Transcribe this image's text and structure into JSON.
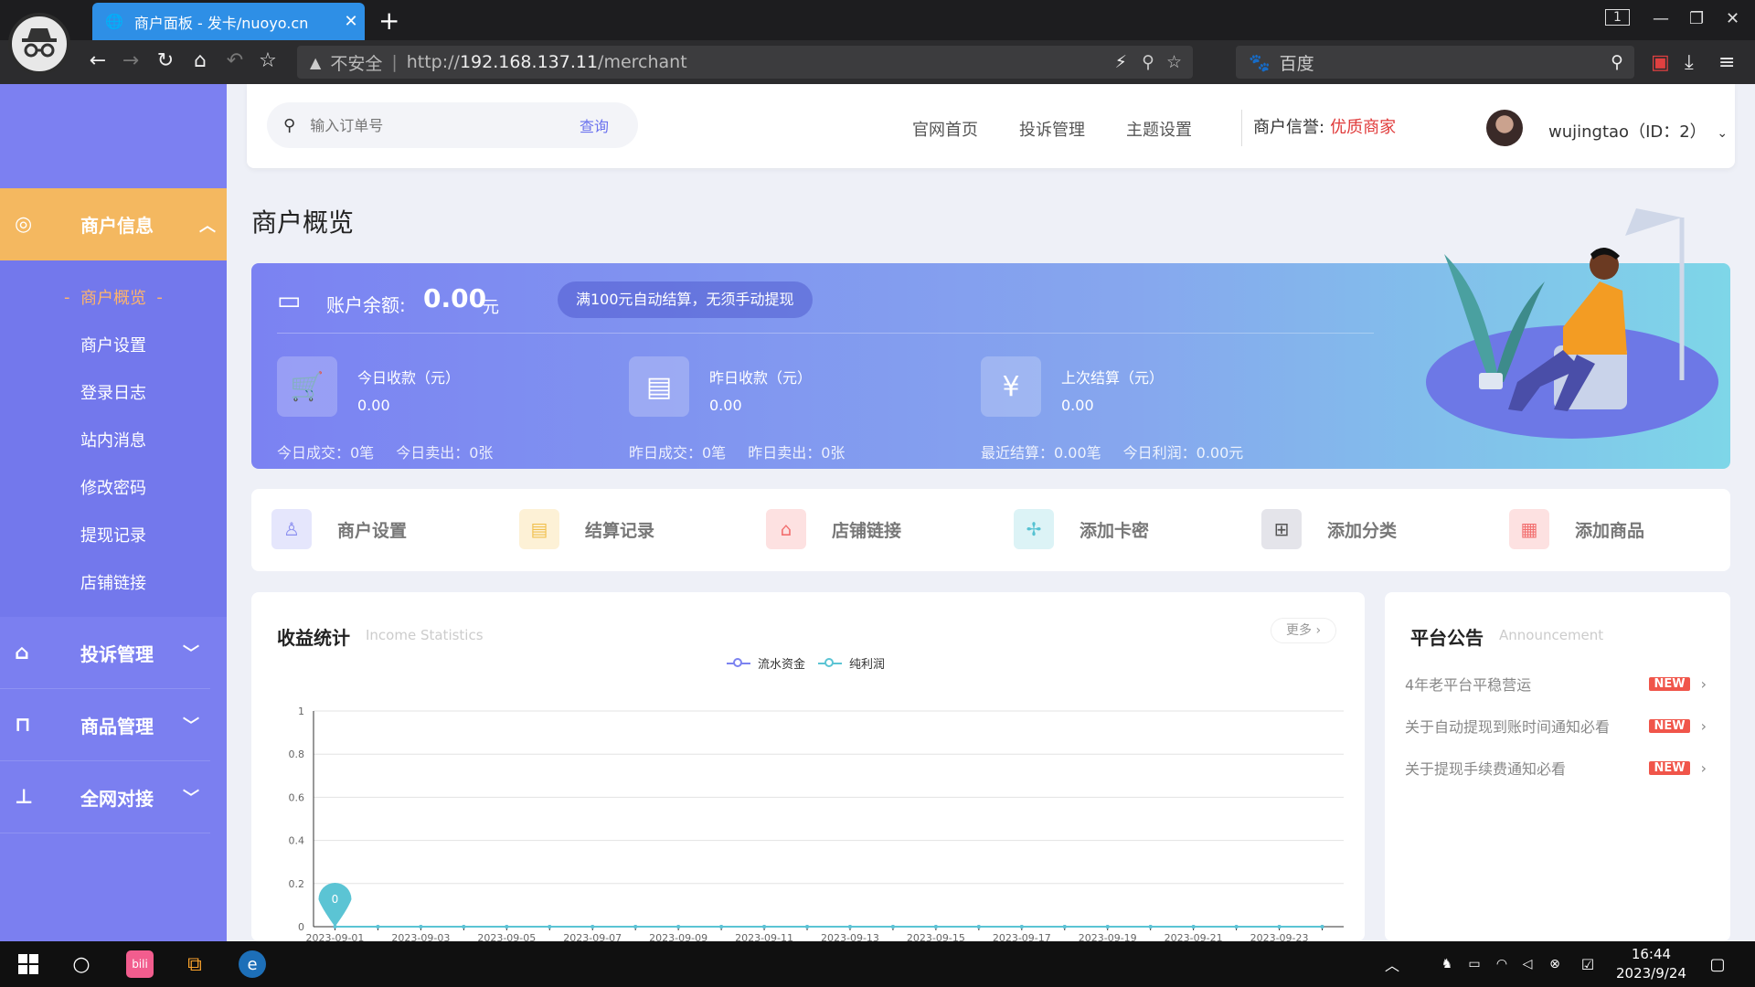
{
  "browser": {
    "tab_title": "商户面板 - 发卡/nuoyo.cn",
    "tab_count": "1",
    "url_warning": "不安全",
    "url_prefix": "http://",
    "url_host": "192.168.137.11",
    "url_path": "/merchant",
    "search_engine": "百度"
  },
  "sidebar": {
    "open_group": "商户信息",
    "sub_items": [
      "商户概览",
      "商户设置",
      "登录日志",
      "站内消息",
      "修改密码",
      "提现记录",
      "店铺链接"
    ],
    "groups": [
      "投诉管理",
      "商品管理",
      "全网对接"
    ]
  },
  "header": {
    "search_placeholder": "输入订单号",
    "search_button": "查询",
    "nav": [
      "官网首页",
      "投诉管理",
      "主题设置"
    ],
    "credit_label": "商户信誉:",
    "credit_value": "优质商家",
    "user": "wujingtao（ID：2）"
  },
  "page_title": "商户概览",
  "balance": {
    "label": "账户余额:",
    "value": "0.00",
    "unit": "元",
    "notice": "满100元自动结算，无须手动提现"
  },
  "stats": [
    {
      "label": "今日收款（元）",
      "value": "0.00",
      "foot1": "今日成交：0笔",
      "foot2": "今日卖出：0张"
    },
    {
      "label": "昨日收款（元）",
      "value": "0.00",
      "foot1": "昨日成交：0笔",
      "foot2": "昨日卖出：0张"
    },
    {
      "label": "上次结算（元）",
      "value": "0.00",
      "foot1": "最近结算：0.00笔",
      "foot2": "今日利润：0.00元"
    }
  ],
  "quick_actions": [
    "商户设置",
    "结算记录",
    "店铺链接",
    "添加卡密",
    "添加分类",
    "添加商品"
  ],
  "income": {
    "title": "收益统计",
    "subtitle": "Income Statistics",
    "more": "更多 ›",
    "pin_label": "0"
  },
  "chart_data": {
    "type": "line",
    "x": [
      "2023-09-01",
      "2023-09-02",
      "2023-09-03",
      "2023-09-04",
      "2023-09-05",
      "2023-09-06",
      "2023-09-07",
      "2023-09-08",
      "2023-09-09",
      "2023-09-10",
      "2023-09-11",
      "2023-09-12",
      "2023-09-13",
      "2023-09-14",
      "2023-09-15",
      "2023-09-16",
      "2023-09-17",
      "2023-09-18",
      "2023-09-19",
      "2023-09-20",
      "2023-09-21",
      "2023-09-22",
      "2023-09-23",
      "2023-09-24"
    ],
    "x_tick_labels": [
      "2023-09-01",
      "2023-09-03",
      "2023-09-05",
      "2023-09-07",
      "2023-09-09",
      "2023-09-11",
      "2023-09-13",
      "2023-09-15",
      "2023-09-17",
      "2023-09-19",
      "2023-09-21",
      "2023-09-23"
    ],
    "y_ticks": [
      "0",
      "0.2",
      "0.4",
      "0.6",
      "0.8",
      "1"
    ],
    "ylim": [
      0,
      1
    ],
    "series": [
      {
        "name": "流水资金",
        "color": "#7c83f0",
        "values": [
          0,
          0,
          0,
          0,
          0,
          0,
          0,
          0,
          0,
          0,
          0,
          0,
          0,
          0,
          0,
          0,
          0,
          0,
          0,
          0,
          0,
          0,
          0,
          0
        ]
      },
      {
        "name": "纯利润",
        "color": "#5bc4d4",
        "values": [
          0,
          0,
          0,
          0,
          0,
          0,
          0,
          0,
          0,
          0,
          0,
          0,
          0,
          0,
          0,
          0,
          0,
          0,
          0,
          0,
          0,
          0,
          0,
          0
        ]
      }
    ],
    "grid": true,
    "legend": "top-center"
  },
  "announce": {
    "title": "平台公告",
    "subtitle": "Announcement",
    "badge": "NEW",
    "items": [
      "4年老平台平稳营运",
      "关于自动提现到账时间通知必看",
      "关于提现手续费通知必看"
    ]
  },
  "taskbar": {
    "time": "16:44",
    "date": "2023/9/24"
  }
}
